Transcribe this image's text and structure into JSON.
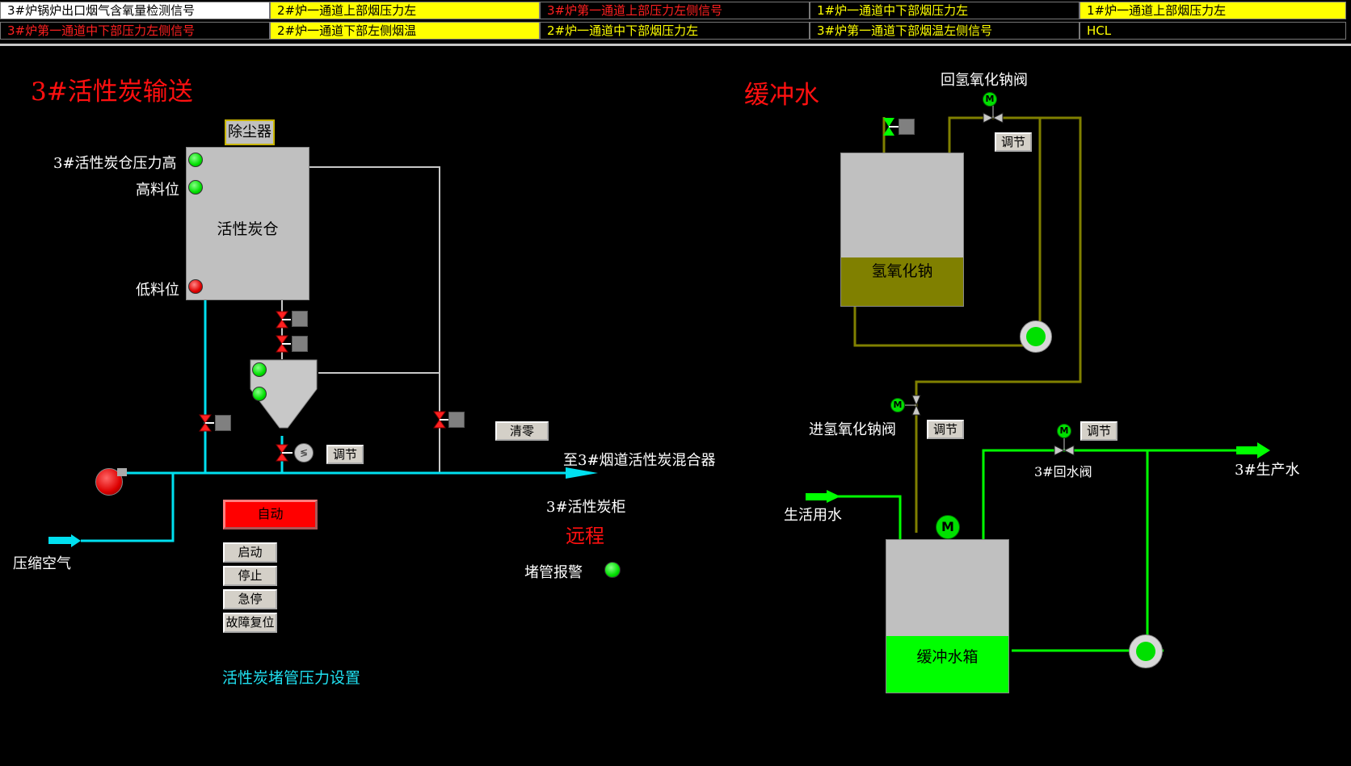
{
  "alarms": [
    {
      "text": "3#炉锅炉出口烟气含氧量检测信号",
      "style": "white"
    },
    {
      "text": "2#炉一通道上部烟压力左",
      "style": "yellow"
    },
    {
      "text": "3#炉第一通道上部压力左侧信号",
      "style": "black-red"
    },
    {
      "text": "1#炉一通道中下部烟压力左",
      "style": "black-yellow"
    },
    {
      "text": "1#炉一通道上部烟压力左",
      "style": "yellow"
    },
    {
      "text": "3#炉第一通道中下部压力左侧信号",
      "style": "black-red"
    },
    {
      "text": "2#炉一通道下部左侧烟温",
      "style": "yellow"
    },
    {
      "text": "2#炉一通道中下部烟压力左",
      "style": "black-yellow"
    },
    {
      "text": "3#炉第一通道下部烟温左侧信号",
      "style": "black-yellow"
    },
    {
      "text": "HCL",
      "style": "black-yellow"
    }
  ],
  "carbon": {
    "title": "3#活性炭输送",
    "dust_collector": "除尘器",
    "silo_label": "活性炭仓",
    "pressure_high": "3#活性炭仓压力高",
    "high_level": "高料位",
    "low_level": "低料位",
    "adjust_label": "调节",
    "clear_button": "清零",
    "to_mixer": "至3#烟道活性炭混合器",
    "cabinet": "3#活性炭柜",
    "remote": "远程",
    "blockage_alarm": "堵管报警",
    "compressed_air": "压缩空气",
    "auto_button": "自动",
    "start_button": "启动",
    "stop_button": "停止",
    "estop_button": "急停",
    "reset_button": "故障复位",
    "pressure_setting": "活性炭堵管压力设置"
  },
  "buffer": {
    "title": "缓冲水",
    "return_naoh_valve": "回氢氧化钠阀",
    "naoh_tank": "氢氧化钠",
    "inlet_naoh_valve": "进氢氧化钠阀",
    "adjust_label": "调节",
    "return_water_valve": "3#回水阀",
    "production_water": "3#生产水",
    "domestic_water": "生活用水",
    "buffer_tank": "缓冲水箱",
    "motor_label": "M"
  },
  "colors": {
    "cyan_pipe": "#00e0f0",
    "olive_pipe": "#808000",
    "green_pipe": "#00ff00",
    "gray_pipe": "#c8c8c8"
  }
}
